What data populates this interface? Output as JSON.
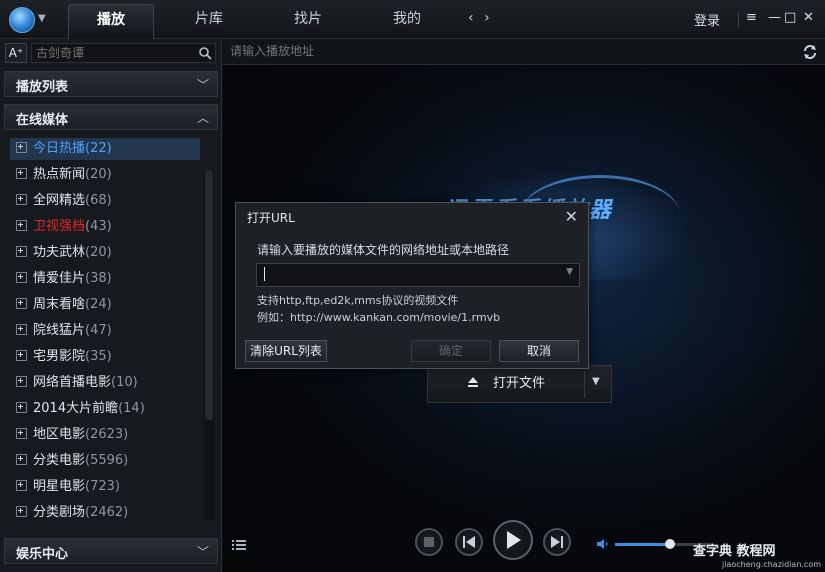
{
  "topbar": {
    "tabs": [
      {
        "label": "播放",
        "active": true
      },
      {
        "label": "片库",
        "active": false
      },
      {
        "label": "找片",
        "active": false
      },
      {
        "label": "我的",
        "active": false
      }
    ],
    "back_label": "‹",
    "forward_label": "›",
    "login_label": "登录",
    "window_buttons": {
      "menu": "≡",
      "minimize": "—",
      "maximize": "□",
      "close": "✕"
    }
  },
  "sidebar": {
    "font_button": "A⁺",
    "search_placeholder": "古剑奇谭",
    "sections": {
      "playlist": "播放列表",
      "online_media": "在线媒体",
      "entertainment": "娱乐中心"
    },
    "items": [
      {
        "label": "今日热播",
        "count": "(22)"
      },
      {
        "label": "热点新闻",
        "count": "(20)"
      },
      {
        "label": "全网精选",
        "count": "(68)"
      },
      {
        "label": "卫视强档",
        "count": "(43)"
      },
      {
        "label": "功夫武林",
        "count": "(20)"
      },
      {
        "label": "情爱佳片",
        "count": "(38)"
      },
      {
        "label": "周末看啥",
        "count": "(24)"
      },
      {
        "label": "院线猛片",
        "count": "(47)"
      },
      {
        "label": "宅男影院",
        "count": "(35)"
      },
      {
        "label": "网络首播电影",
        "count": "(10)"
      },
      {
        "label": "2014大片前瞻",
        "count": "(14)"
      },
      {
        "label": "地区电影",
        "count": "(2623)"
      },
      {
        "label": "分类电影",
        "count": "(5596)"
      },
      {
        "label": "明星电影",
        "count": "(723)"
      },
      {
        "label": "分类剧场",
        "count": "(2462)"
      }
    ]
  },
  "main": {
    "address_placeholder": "请输入播放地址",
    "brand_text": "迅雷看看播放器",
    "open_file_label": "打开文件",
    "volume_level": 0.58
  },
  "dialog": {
    "title": "打开URL",
    "prompt": "请输入要播放的媒体文件的网络地址或本地路径",
    "url_value": "",
    "support_text": "支持http,ftp,ed2k,mms协议的视频文件",
    "example_text": "例如：http://www.kankan.com/movie/1.rmvb",
    "clear_button": "清除URL列表",
    "ok_button": "确定",
    "cancel_button": "取消"
  },
  "watermark": {
    "title": "查字典 教程网",
    "url": "jiaocheng.chazidian.com"
  },
  "colors": {
    "accent": "#4aa3ff",
    "highlight_red": "#e02a2a",
    "background": "#0b0d10"
  }
}
